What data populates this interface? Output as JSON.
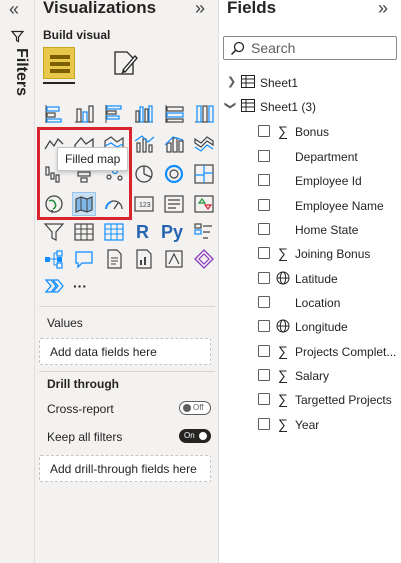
{
  "filters_rail": {
    "title": "Filters",
    "collapse_glyph": "«"
  },
  "visualizations": {
    "title": "Visualizations",
    "collapse_glyph": "»",
    "build_visual_label": "Build visual",
    "tooltip": "Filled map",
    "more_glyph": "···",
    "values": {
      "label": "Values",
      "placeholder": "Add data fields here"
    },
    "drill_through": {
      "label": "Drill through",
      "cross_report": {
        "label": "Cross-report",
        "state": "Off"
      },
      "keep_all_filters": {
        "label": "Keep all filters",
        "state": "On"
      },
      "placeholder": "Add drill-through fields here"
    },
    "icons": [
      "stacked-bar-chart-icon",
      "stacked-column-chart-icon",
      "clustered-bar-chart-icon",
      "clustered-column-chart-icon",
      "100-stacked-bar-chart-icon",
      "100-stacked-column-chart-icon",
      "line-chart-icon",
      "area-chart-icon",
      "stacked-area-chart-icon",
      "line-clustered-column-icon",
      "line-stacked-column-icon",
      "ribbon-chart-icon",
      "waterfall-chart-icon",
      "funnel-chart-icon",
      "scatter-chart-icon",
      "pie-chart-icon",
      "donut-chart-icon",
      "treemap-icon",
      "map-icon",
      "filled-map-icon",
      "gauge-icon",
      "card-icon",
      "multi-row-card-icon",
      "kpi-icon",
      "slicer-icon",
      "table-icon",
      "matrix-icon",
      "r-visual-icon",
      "python-visual-icon",
      "key-influencers-icon",
      "decomposition-tree-icon",
      "qa-icon",
      "smart-narrative-icon",
      "paginated-report-icon",
      "power-apps-icon",
      "power-automate-icon",
      "get-more-visuals-icon",
      "more-icon"
    ],
    "r_label": "R",
    "py_label": "Py"
  },
  "fields": {
    "title": "Fields",
    "collapse_glyph": "»",
    "search_placeholder": "Search",
    "tables": [
      {
        "name": "Sheet1",
        "expanded": false
      },
      {
        "name": "Sheet1 (3)",
        "expanded": true
      }
    ],
    "items": [
      {
        "name": "Bonus",
        "type": "sum"
      },
      {
        "name": "Department",
        "type": "text"
      },
      {
        "name": "Employee Id",
        "type": "text"
      },
      {
        "name": "Employee Name",
        "type": "text"
      },
      {
        "name": "Home State",
        "type": "text"
      },
      {
        "name": "Joining Bonus",
        "type": "sum"
      },
      {
        "name": "Latitude",
        "type": "geo"
      },
      {
        "name": "Location",
        "type": "text"
      },
      {
        "name": "Longitude",
        "type": "geo"
      },
      {
        "name": "Projects Complet...",
        "type": "sum"
      },
      {
        "name": "Salary",
        "type": "sum"
      },
      {
        "name": "Targetted Projects",
        "type": "sum"
      },
      {
        "name": "Year",
        "type": "sum"
      }
    ],
    "sum_glyph": "∑",
    "geo_glyph": "⊕"
  },
  "colors": {
    "accent_red": "#d9232e",
    "build_yellow": "#e7c84a",
    "pane_bg": "#f3f2f1"
  }
}
